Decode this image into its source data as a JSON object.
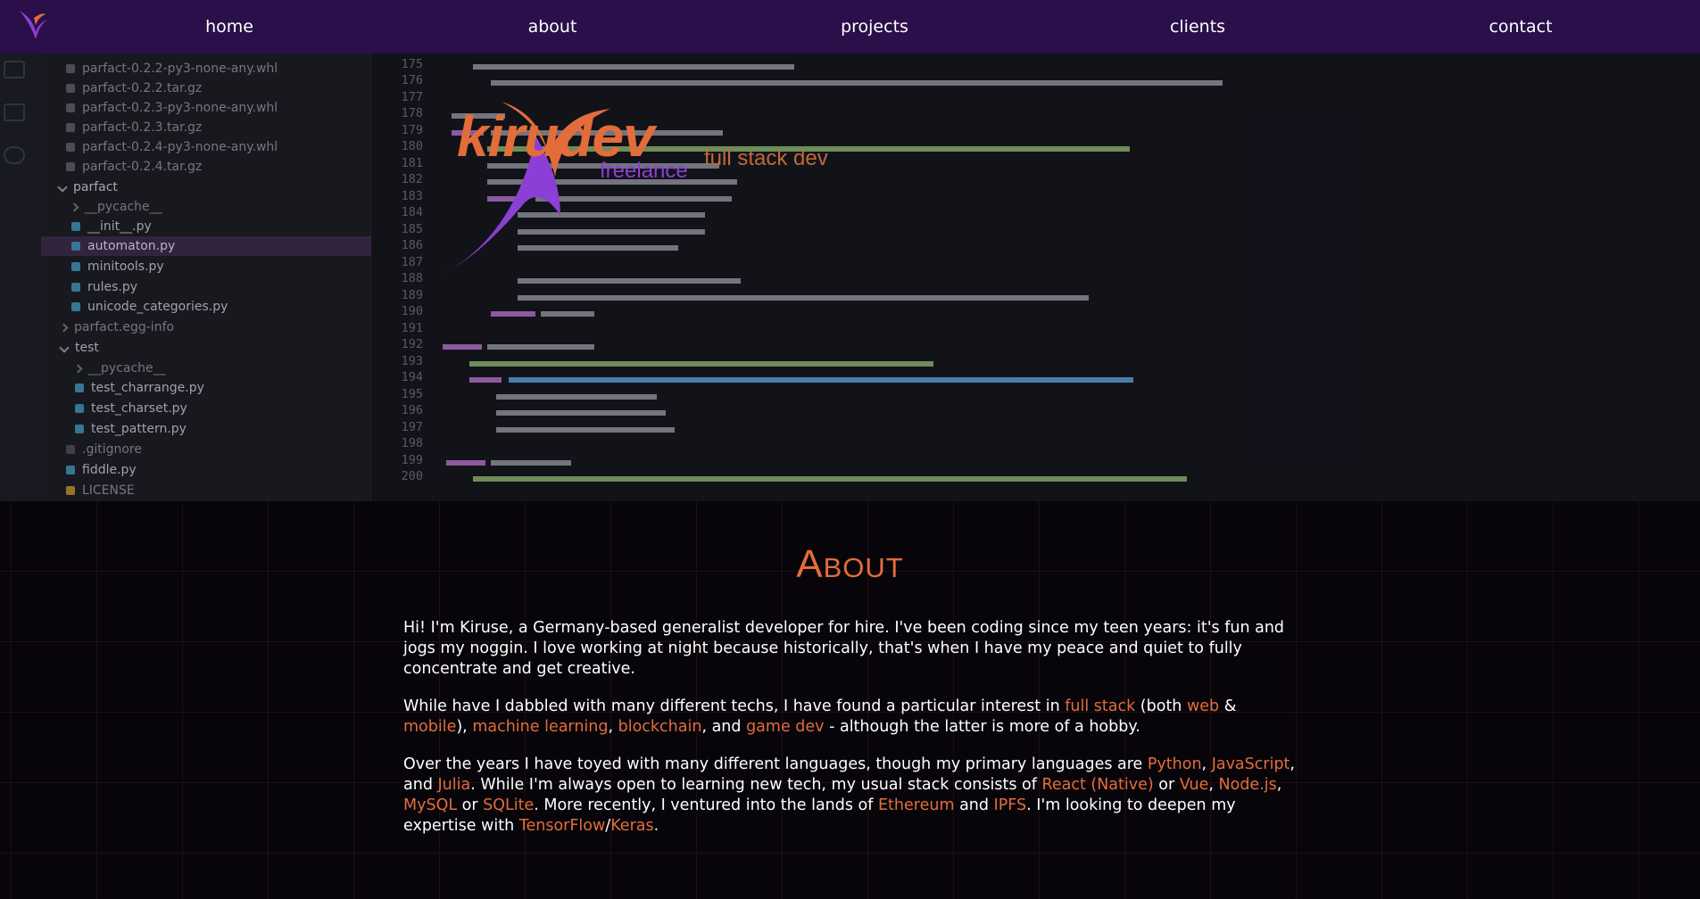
{
  "nav": {
    "logo_icon": "swallow-logo-icon",
    "items": [
      {
        "label": "home"
      },
      {
        "label": "about"
      },
      {
        "label": "projects"
      },
      {
        "label": "clients"
      },
      {
        "label": "contact"
      }
    ]
  },
  "hero": {
    "brand_name": "kirudev",
    "brand_sub": "freelance",
    "brand_tag": "full stack dev",
    "file_tree": [
      "parfact-0.2.2-py3-none-any.whl",
      "parfact-0.2.2.tar.gz",
      "parfact-0.2.3-py3-none-any.whl",
      "parfact-0.2.3.tar.gz",
      "parfact-0.2.4-py3-none-any.whl",
      "parfact-0.2.4.tar.gz",
      "parfact",
      "__pycache__",
      "__init__.py",
      "automaton.py",
      "minitools.py",
      "rules.py",
      "unicode_categories.py",
      "parfact.egg-info",
      "test",
      "__pycache__",
      "test_charrange.py",
      "test_charset.py",
      "test_pattern.py",
      ".gitignore",
      "fiddle.py",
      "LICENSE"
    ],
    "line_numbers": [
      "175",
      "176",
      "177",
      "178",
      "179",
      "180",
      "181",
      "182",
      "183",
      "184",
      "185",
      "186",
      "187",
      "188",
      "189",
      "190",
      "191",
      "192",
      "193",
      "194",
      "195",
      "196",
      "197",
      "198",
      "199",
      "200"
    ]
  },
  "about": {
    "title": "About",
    "p1": "Hi! I'm Kiruse, a Germany-based generalist developer for hire. I've been coding since my teen years: it's fun and jogs my noggin. I love working at night because historically, that's when I have my peace and quiet to fully concentrate and get creative.",
    "p2": {
      "t1": "While have I dabbled with many different techs, I have found a particular interest in ",
      "l1": "full stack",
      "t2": " (both ",
      "l2": "web",
      "t3": " & ",
      "l3": "mobile",
      "t4": "), ",
      "l4": "machine learning",
      "t5": ", ",
      "l5": "blockchain",
      "t6": ", and ",
      "l6": "game dev",
      "t7": " - although the latter is more of a hobby."
    },
    "p3": {
      "t1": "Over the years I have toyed with many different languages, though my primary languages are ",
      "l1": "Python",
      "t2": ", ",
      "l2": "JavaScript",
      "t3": ", and ",
      "l3": "Julia",
      "t4": ". While I'm always open to learning new tech, my usual stack consists of ",
      "l4": "React (Native)",
      "t5": " or ",
      "l5": "Vue",
      "t6": ", ",
      "l6": "Node.js",
      "t7": ", ",
      "l7": "MySQL",
      "t8": " or ",
      "l8": "SQLite",
      "t9": ". More recently, I ventured into the lands of ",
      "l9": "Ethereum",
      "t10": " and ",
      "l10": "IPFS",
      "t11": ". I'm looking to deepen my expertise with ",
      "l11": "TensorFlow",
      "t12": "/",
      "l12": "Keras",
      "t13": "."
    }
  },
  "colors": {
    "nav_bg": "#2a0f4a",
    "accent": "#e36d3a",
    "purple": "#8b3fd4",
    "page_bg": "#07050a"
  }
}
